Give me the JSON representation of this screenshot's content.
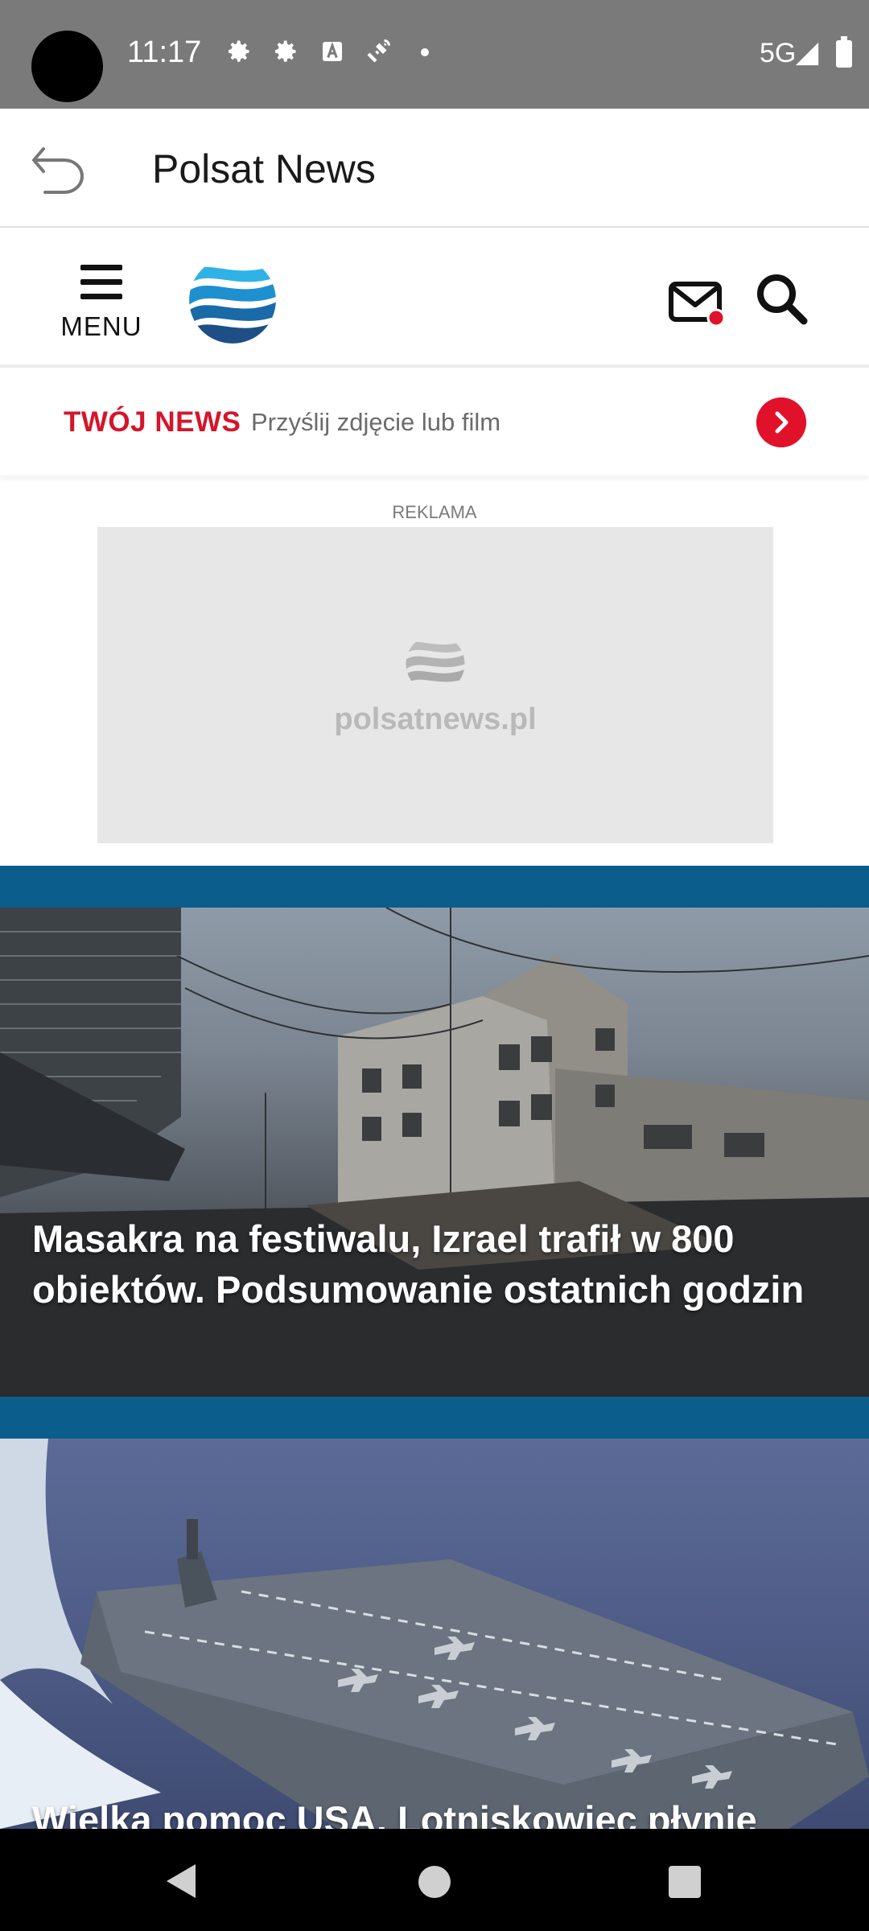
{
  "status_bar": {
    "time": "11:17",
    "network": "5G",
    "icons": [
      "settings-icon",
      "settings-icon",
      "font-icon",
      "satellite-icon",
      "notification-dot",
      "signal-icon",
      "battery-icon"
    ]
  },
  "app_bar": {
    "title": "Polsat News",
    "back_icon": "back-arrow-icon"
  },
  "site_header": {
    "menu_label": "MENU",
    "logo_icon": "polsat-news-wave-logo",
    "mail_icon": "mail-icon",
    "search_icon": "search-icon",
    "colors": {
      "logo_primary": "#1f9bd7",
      "logo_dark": "#1d4f86",
      "notification": "#e1112b"
    }
  },
  "twoj_news": {
    "brand": "TWÓJ NEWS",
    "text": "Przyślij zdjęcie lub film",
    "go_icon": "chevron-right-icon",
    "brand_color": "#d5152b"
  },
  "ad": {
    "label": "REKLAMA",
    "placeholder_text": "polsatnews.pl"
  },
  "articles": [
    {
      "title": "Masakra na festiwalu, Izrael trafił w 800 obiektów. Podsumowanie ostatnich godzin",
      "image": "destroyed-buildings-photo"
    },
    {
      "title": "Wielka pomoc USA. Lotniskowiec płynie",
      "image": "aircraft-carrier-photo"
    }
  ],
  "section_band_color": "#0b5e8b",
  "nav_bar": {
    "back_icon": "nav-back-icon",
    "home_icon": "nav-home-icon",
    "recents_icon": "nav-recents-icon"
  }
}
